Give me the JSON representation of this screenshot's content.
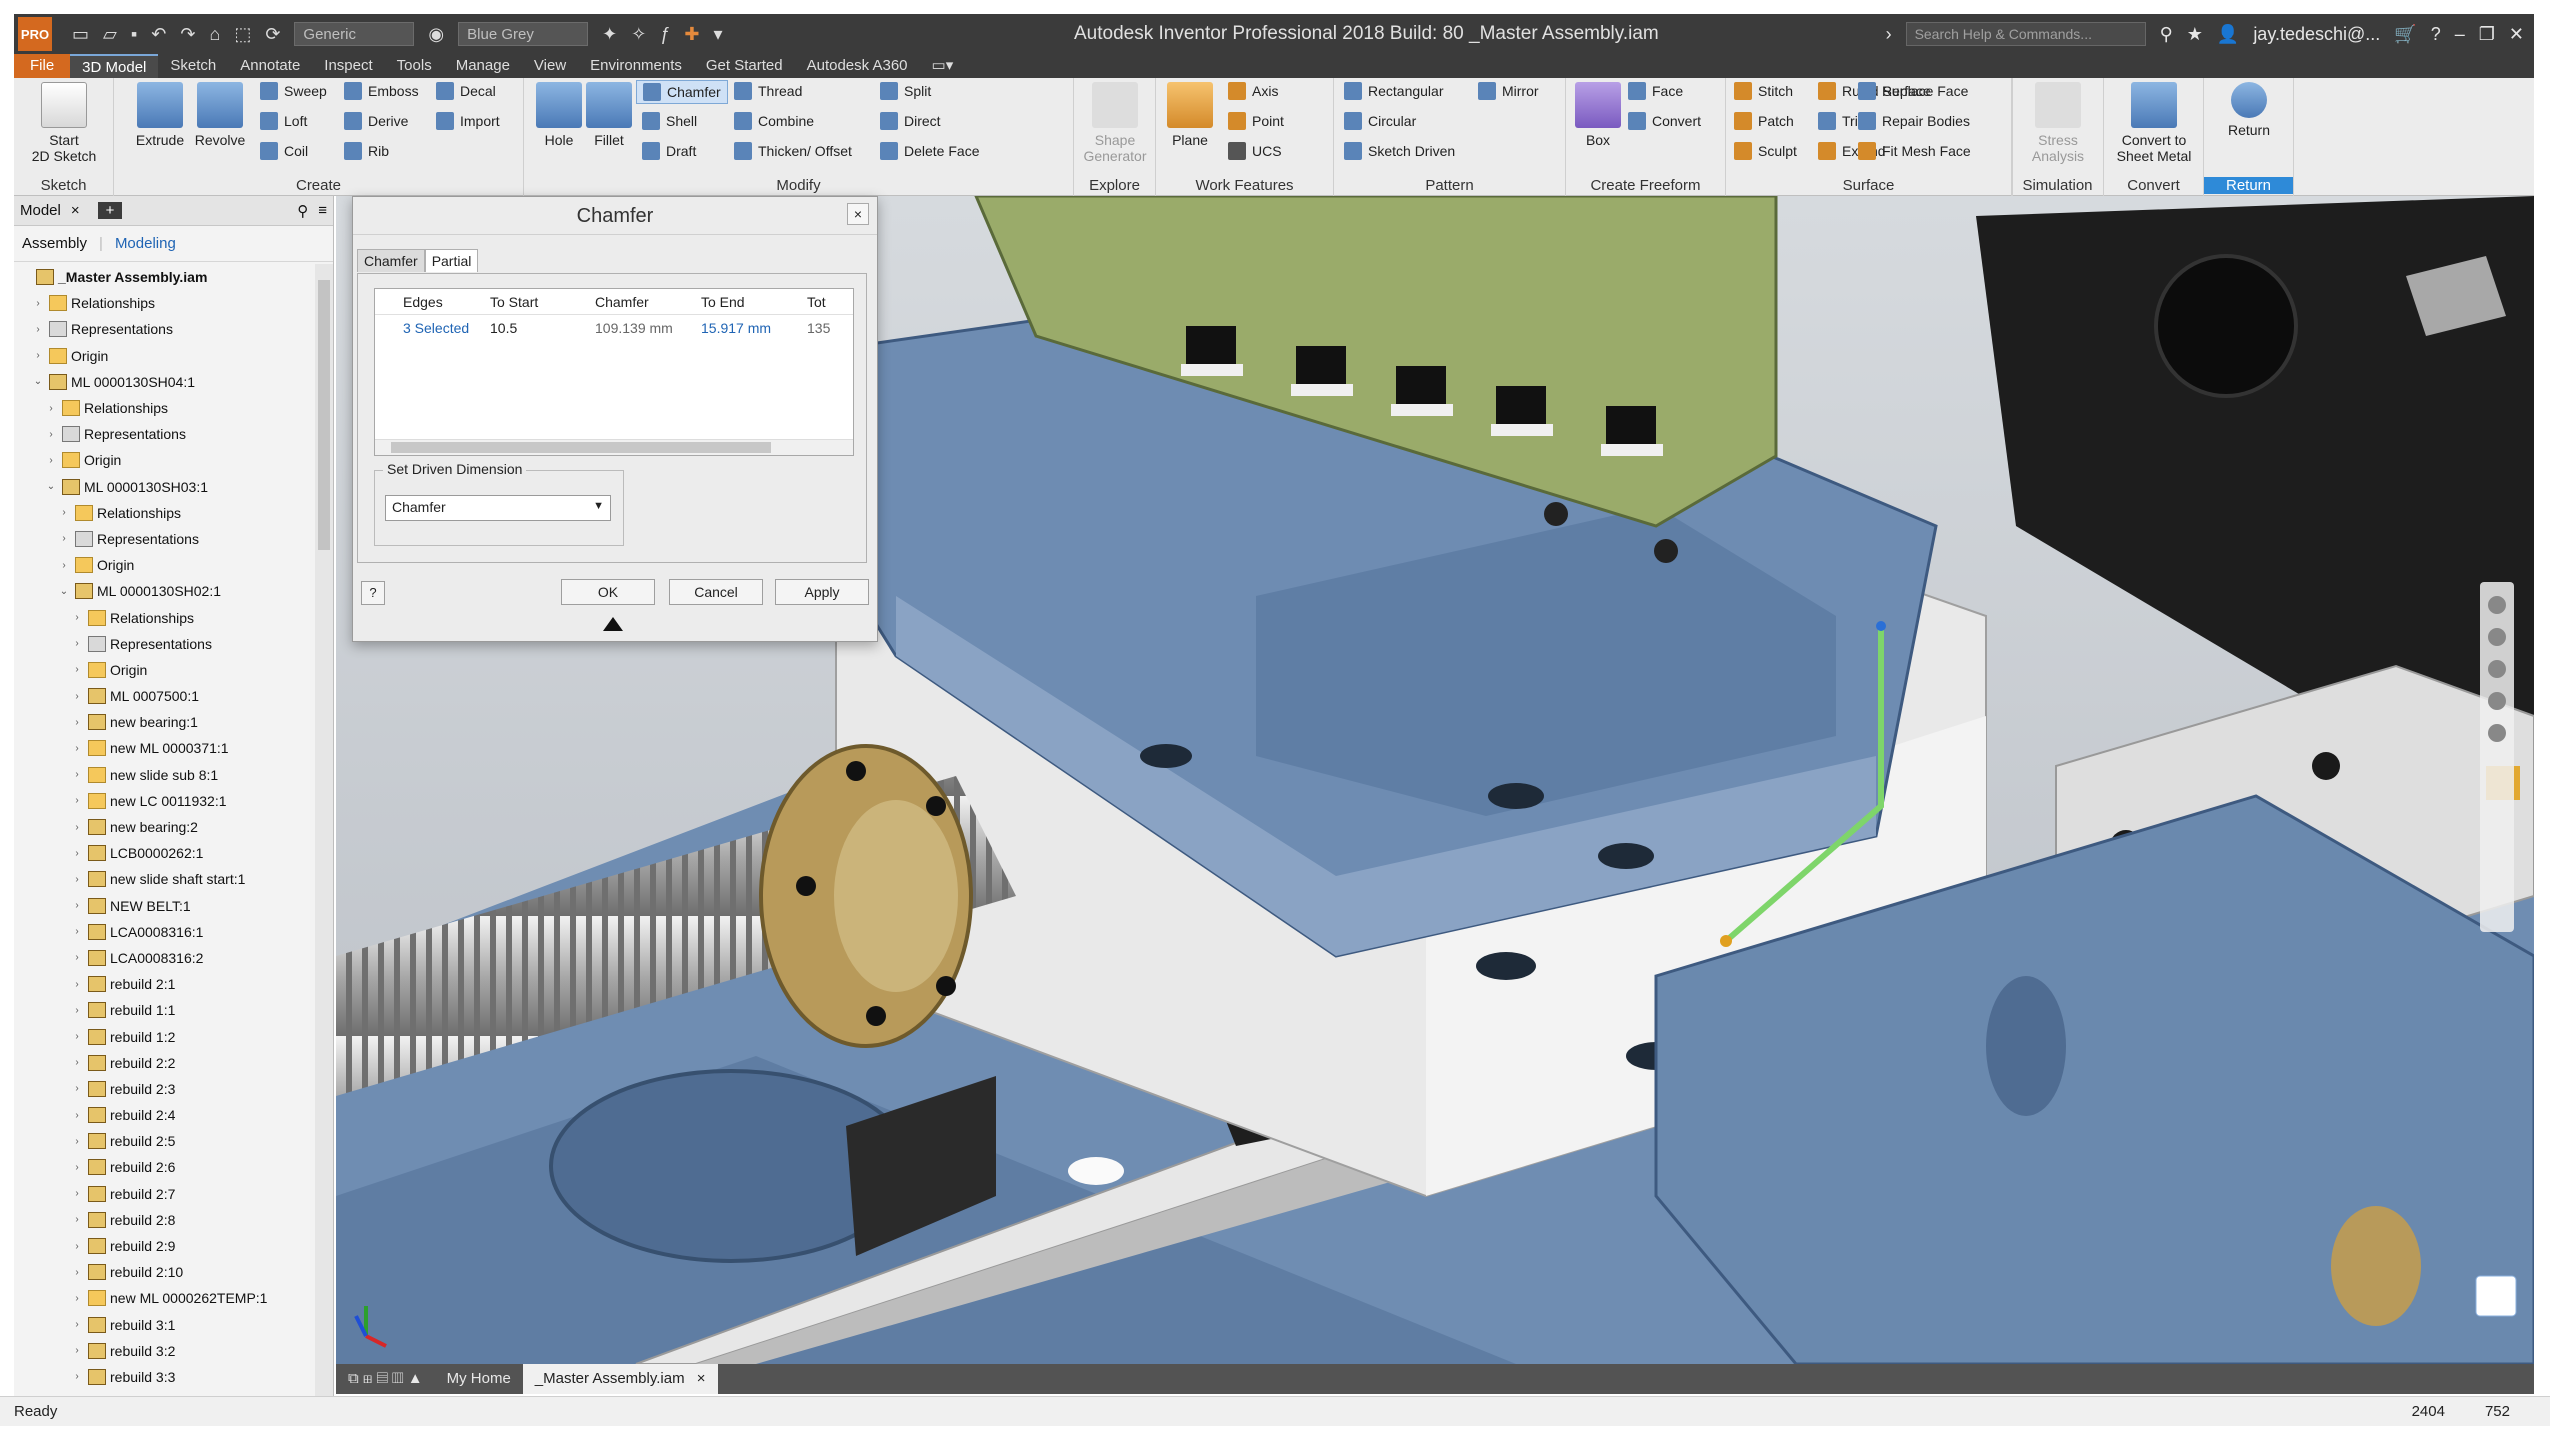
{
  "app": {
    "title": "Autodesk Inventor Professional 2018 Build: 80   _Master Assembly.iam",
    "logo": "PRO",
    "qat_combo_material": "Generic",
    "qat_combo_appearance": "Blue Grey",
    "search_placeholder": "Search Help & Commands...",
    "user": "jay.tedeschi@...",
    "help": "?"
  },
  "ribbon_tabs": [
    "File",
    "3D Model",
    "Sketch",
    "Annotate",
    "Inspect",
    "Tools",
    "Manage",
    "View",
    "Environments",
    "Get Started",
    "Autodesk A360"
  ],
  "ribbon": {
    "sketch": {
      "label": "Sketch",
      "start": "Start\n2D Sketch"
    },
    "create": {
      "label": "Create",
      "extrude": "Extrude",
      "revolve": "Revolve",
      "sweep": "Sweep",
      "loft": "Loft",
      "coil": "Coil",
      "emboss": "Emboss",
      "derive": "Derive",
      "rib": "Rib",
      "decal": "Decal",
      "import": "Import"
    },
    "modify": {
      "label": "Modify",
      "hole": "Hole",
      "fillet": "Fillet",
      "chamfer": "Chamfer",
      "shell": "Shell",
      "draft": "Draft",
      "thread": "Thread",
      "combine": "Combine",
      "thicken": "Thicken/ Offset",
      "split": "Split",
      "direct": "Direct",
      "delete_face": "Delete Face"
    },
    "explore": {
      "label": "Explore",
      "shape_generator": "Shape\nGenerator"
    },
    "work_features": {
      "label": "Work Features",
      "plane": "Plane",
      "axis": "Axis",
      "point": "Point",
      "ucs": "UCS"
    },
    "pattern": {
      "label": "Pattern",
      "rectangular": "Rectangular",
      "circular": "Circular",
      "sketch_driven": "Sketch Driven",
      "mirror": "Mirror"
    },
    "freeform": {
      "label": "Create Freeform",
      "box": "Box",
      "face": "Face",
      "convert": "Convert"
    },
    "surface": {
      "label": "Surface",
      "stitch": "Stitch",
      "patch": "Patch",
      "sculpt": "Sculpt",
      "ruled": "Ruled Surface",
      "trim": "Trim",
      "extend": "Extend",
      "replace": "Replace Face",
      "repair": "Repair Bodies",
      "fit_mesh": "Fit Mesh Face"
    },
    "simulation": {
      "label": "Simulation",
      "stress": "Stress\nAnalysis"
    },
    "convert": {
      "label": "Convert",
      "sheet_metal": "Convert to\nSheet Metal"
    },
    "return": {
      "label": "Return",
      "return": "Return"
    }
  },
  "browser": {
    "tab_label": "Model",
    "close": "×",
    "add": "+",
    "sub_assembly": "Assembly",
    "sub_modeling": "Modeling",
    "items": [
      {
        "label": "_Master Assembly.iam",
        "level": 0,
        "icon": "asm",
        "arrow": ""
      },
      {
        "label": "Relationships",
        "level": 1,
        "icon": "folder",
        "arrow": "›"
      },
      {
        "label": "Representations",
        "level": 1,
        "icon": "rep",
        "arrow": "›"
      },
      {
        "label": "Origin",
        "level": 1,
        "icon": "folder",
        "arrow": "›"
      },
      {
        "label": "ML 0000130SH04:1",
        "level": 1,
        "icon": "asm",
        "arrow": "⌄"
      },
      {
        "label": "Relationships",
        "level": 2,
        "icon": "folder",
        "arrow": "›"
      },
      {
        "label": "Representations",
        "level": 2,
        "icon": "rep",
        "arrow": "›"
      },
      {
        "label": "Origin",
        "level": 2,
        "icon": "folder",
        "arrow": "›"
      },
      {
        "label": "ML 0000130SH03:1",
        "level": 2,
        "icon": "asm",
        "arrow": "⌄"
      },
      {
        "label": "Relationships",
        "level": 3,
        "icon": "folder",
        "arrow": "›"
      },
      {
        "label": "Representations",
        "level": 3,
        "icon": "rep",
        "arrow": "›"
      },
      {
        "label": "Origin",
        "level": 3,
        "icon": "folder",
        "arrow": "›"
      },
      {
        "label": "ML 0000130SH02:1",
        "level": 3,
        "icon": "asm",
        "arrow": "⌄"
      },
      {
        "label": "Relationships",
        "level": 4,
        "icon": "folder",
        "arrow": "›"
      },
      {
        "label": "Representations",
        "level": 4,
        "icon": "rep",
        "arrow": "›"
      },
      {
        "label": "Origin",
        "level": 4,
        "icon": "folder",
        "arrow": "›"
      },
      {
        "label": "ML 0007500:1",
        "level": 4,
        "icon": "asm",
        "arrow": "›"
      },
      {
        "label": "new bearing:1",
        "level": 4,
        "icon": "asm",
        "arrow": "›"
      },
      {
        "label": "new ML 0000371:1",
        "level": 4,
        "icon": "folder",
        "arrow": "›"
      },
      {
        "label": "new slide sub 8:1",
        "level": 4,
        "icon": "folder",
        "arrow": "›"
      },
      {
        "label": "new LC 0011932:1",
        "level": 4,
        "icon": "folder",
        "arrow": "›"
      },
      {
        "label": "new bearing:2",
        "level": 4,
        "icon": "asm",
        "arrow": "›"
      },
      {
        "label": "LCB0000262:1",
        "level": 4,
        "icon": "asm",
        "arrow": "›"
      },
      {
        "label": "new slide shaft start:1",
        "level": 4,
        "icon": "asm",
        "arrow": "›"
      },
      {
        "label": "NEW BELT:1",
        "level": 4,
        "icon": "asm",
        "arrow": "›"
      },
      {
        "label": "LCA0008316:1",
        "level": 4,
        "icon": "asm",
        "arrow": "›"
      },
      {
        "label": "LCA0008316:2",
        "level": 4,
        "icon": "asm",
        "arrow": "›"
      },
      {
        "label": "rebuild 2:1",
        "level": 4,
        "icon": "asm",
        "arrow": "›"
      },
      {
        "label": "rebuild 1:1",
        "level": 4,
        "icon": "asm",
        "arrow": "›"
      },
      {
        "label": "rebuild 1:2",
        "level": 4,
        "icon": "asm",
        "arrow": "›"
      },
      {
        "label": "rebuild 2:2",
        "level": 4,
        "icon": "asm",
        "arrow": "›"
      },
      {
        "label": "rebuild 2:3",
        "level": 4,
        "icon": "asm",
        "arrow": "›"
      },
      {
        "label": "rebuild 2:4",
        "level": 4,
        "icon": "asm",
        "arrow": "›"
      },
      {
        "label": "rebuild 2:5",
        "level": 4,
        "icon": "asm",
        "arrow": "›"
      },
      {
        "label": "rebuild 2:6",
        "level": 4,
        "icon": "asm",
        "arrow": "›"
      },
      {
        "label": "rebuild 2:7",
        "level": 4,
        "icon": "asm",
        "arrow": "›"
      },
      {
        "label": "rebuild 2:8",
        "level": 4,
        "icon": "asm",
        "arrow": "›"
      },
      {
        "label": "rebuild 2:9",
        "level": 4,
        "icon": "asm",
        "arrow": "›"
      },
      {
        "label": "rebuild 2:10",
        "level": 4,
        "icon": "asm",
        "arrow": "›"
      },
      {
        "label": "new ML 0000262TEMP:1",
        "level": 4,
        "icon": "folder",
        "arrow": "›"
      },
      {
        "label": "rebuild 3:1",
        "level": 4,
        "icon": "asm",
        "arrow": "›"
      },
      {
        "label": "rebuild 3:2",
        "level": 4,
        "icon": "asm",
        "arrow": "›"
      },
      {
        "label": "rebuild 3:3",
        "level": 4,
        "icon": "asm",
        "arrow": "›"
      }
    ]
  },
  "dialog": {
    "title": "Chamfer",
    "close": "×",
    "tabs": [
      "Chamfer",
      "Partial"
    ],
    "grid_headers": [
      "Edges",
      "To Start",
      "Chamfer",
      "To End",
      "Tot"
    ],
    "grid_row": [
      "3 Selected",
      "10.5",
      "109.139 mm",
      "15.917 mm",
      "135"
    ],
    "driven_label": "Set Driven Dimension",
    "driven_value": "Chamfer",
    "ok": "OK",
    "cancel": "Cancel",
    "apply": "Apply",
    "help": "?"
  },
  "doc_tabs": {
    "home": "My Home",
    "doc": "_Master Assembly.iam",
    "close": "×"
  },
  "status": {
    "text": "Ready",
    "v1": "2404",
    "v2": "752"
  },
  "colors": {
    "accent_orange": "#d4691f",
    "part_blue_grey": "#6b8bb0",
    "part_olive": "#9aab6a",
    "part_white": "#e6e6e6",
    "part_black": "#1c1c1c",
    "part_gold": "#b89a5a",
    "edge_highlight": "#7ed56a"
  }
}
